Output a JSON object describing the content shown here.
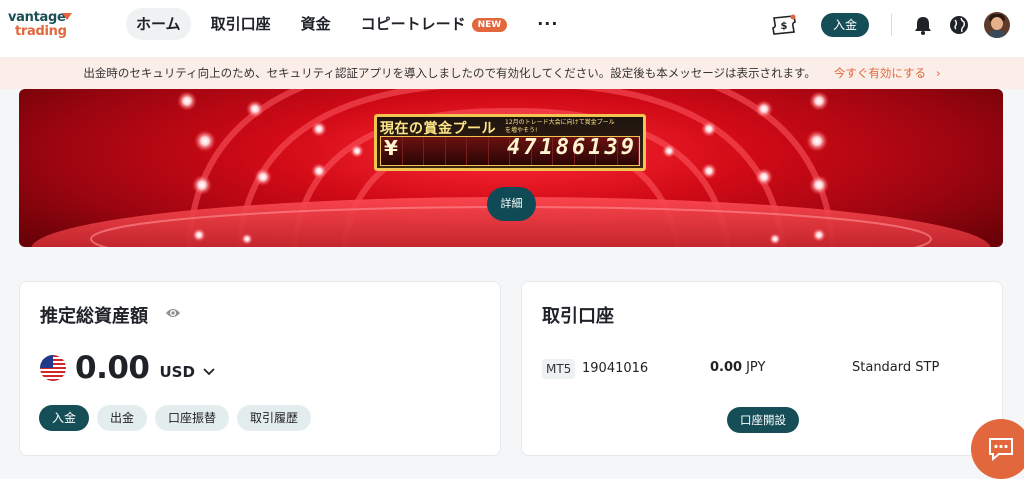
{
  "header": {
    "logo": {
      "line1": "vantage",
      "line2": "trading"
    },
    "nav": [
      {
        "label": "ホーム",
        "active": true
      },
      {
        "label": "取引口座"
      },
      {
        "label": "資金"
      },
      {
        "label": "コピートレード",
        "badge": "NEW"
      }
    ],
    "more_label": "···",
    "deposit_label": "入金",
    "icons": [
      "ticket-dollar-icon",
      "bell-icon",
      "globe-icon",
      "avatar"
    ]
  },
  "notice": {
    "text": "出金時のセキュリティ向上のため、セキュリティ認証アプリを導入しましたので有効化してください。設定後も本メッセージは表示されます。",
    "link_label": "今すぐ有効にする",
    "link_chevron": "›"
  },
  "banner": {
    "pool_title": "現在の賞金プール",
    "pool_sub": "12月のトレード大会に向けて賞金プールを増やそう!",
    "currency_symbol": "¥",
    "pool_amount": "47186139",
    "detail_label": "詳細"
  },
  "assets_card": {
    "title": "推定総資産額",
    "amount": "0.00",
    "currency": "USD",
    "actions": [
      "入金",
      "出金",
      "口座振替",
      "取引履歴"
    ]
  },
  "accounts_card": {
    "title": "取引口座",
    "account": {
      "platform": "MT5",
      "number": "19041016",
      "balance": "0.00",
      "currency": "JPY",
      "type": "Standard STP"
    },
    "open_label": "口座開設"
  },
  "colors": {
    "primary": "#164e57",
    "accent": "#e2673c",
    "notice_bg": "#fbeee8"
  }
}
